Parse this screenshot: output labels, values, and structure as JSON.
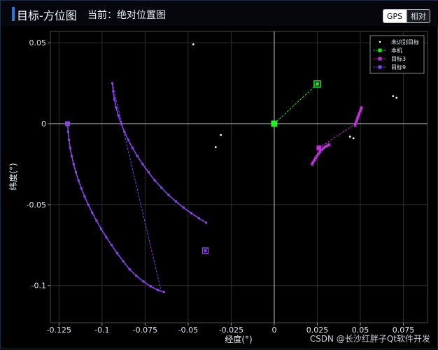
{
  "header": {
    "title": "目标-方位图",
    "subtitle": "当前：绝对位置图",
    "mode_gps": "GPS",
    "mode_relative": "相对"
  },
  "watermark": "CSDN @长沙红胖子Qt软件开发",
  "colors": {
    "unknown": "#ffffff",
    "self": "#22ee22",
    "target3": "#c030d8",
    "target9": "#8a44ee",
    "grid": "#2e2e2e",
    "axis": "#c8c8c8"
  },
  "chart_data": {
    "type": "scatter",
    "xlabel": "经度(°)",
    "ylabel": "纬度(°)",
    "xlim": [
      -0.13,
      0.089
    ],
    "ylim": [
      -0.123,
      0.057
    ],
    "xticks": [
      {
        "v": -0.125,
        "label": "-0.125"
      },
      {
        "v": -0.1,
        "label": "-0.1"
      },
      {
        "v": -0.075,
        "label": "-0.075"
      },
      {
        "v": -0.05,
        "label": "-0.05"
      },
      {
        "v": -0.025,
        "label": "-0.025"
      },
      {
        "v": 0,
        "label": "0"
      },
      {
        "v": 0.025,
        "label": "0.025"
      },
      {
        "v": 0.05,
        "label": "0.05"
      },
      {
        "v": 0.075,
        "label": "0.075"
      }
    ],
    "yticks": [
      {
        "v": 0.05,
        "label": "0.05"
      },
      {
        "v": 0,
        "label": "0"
      },
      {
        "v": -0.05,
        "label": "-0.05"
      },
      {
        "v": -0.1,
        "label": "-0.1"
      }
    ],
    "grid": true,
    "legend_position": "top-right",
    "legend": [
      {
        "name": "未识别目标",
        "color": "#ffffff",
        "marker": "dot"
      },
      {
        "name": "本机",
        "color": "#22ee22",
        "marker": "square"
      },
      {
        "name": "目标3",
        "color": "#c030d8",
        "marker": "square"
      },
      {
        "name": "目标9",
        "color": "#8a44ee",
        "marker": "square"
      }
    ],
    "unknown_points": [
      [
        -0.047,
        0.049
      ],
      [
        -0.031,
        -0.007
      ],
      [
        -0.034,
        -0.0145
      ],
      [
        0.044,
        -0.008
      ],
      [
        0.046,
        -0.009
      ],
      [
        0.069,
        0.017
      ],
      [
        0.071,
        0.016
      ]
    ],
    "self": {
      "position": [
        0.0,
        0.0
      ],
      "link_to": [
        0.025,
        0.0245
      ]
    },
    "target3": {
      "track": [
        [
          0.022,
          -0.025
        ],
        [
          0.0225,
          -0.0238
        ],
        [
          0.0232,
          -0.0226
        ],
        [
          0.024,
          -0.0213
        ],
        [
          0.0248,
          -0.02
        ],
        [
          0.0256,
          -0.0187
        ],
        [
          0.0265,
          -0.0174
        ],
        [
          0.0275,
          -0.0162
        ],
        [
          0.0285,
          -0.0152
        ],
        [
          0.0296,
          -0.0143
        ],
        [
          0.0308,
          -0.0136
        ],
        [
          0.0319,
          -0.013
        ]
      ],
      "track2": [
        [
          0.047,
          -0.001
        ],
        [
          0.0474,
          0.0005
        ],
        [
          0.0479,
          0.002
        ],
        [
          0.0484,
          0.0035
        ],
        [
          0.0489,
          0.005
        ],
        [
          0.0494,
          0.0064
        ],
        [
          0.0499,
          0.0077
        ],
        [
          0.0503,
          0.0089
        ],
        [
          0.0506,
          0.0099
        ]
      ],
      "current": [
        0.026,
        -0.015
      ],
      "link_to": [
        0.046,
        -0.001
      ]
    },
    "target9": {
      "track": [
        [
          -0.12,
          0.0
        ],
        [
          -0.1197,
          -0.005
        ],
        [
          -0.1192,
          -0.01
        ],
        [
          -0.1185,
          -0.015
        ],
        [
          -0.1176,
          -0.02
        ],
        [
          -0.1165,
          -0.025
        ],
        [
          -0.1152,
          -0.03
        ],
        [
          -0.1137,
          -0.035
        ],
        [
          -0.112,
          -0.04
        ],
        [
          -0.1101,
          -0.045
        ],
        [
          -0.108,
          -0.05
        ],
        [
          -0.1057,
          -0.055
        ],
        [
          -0.1032,
          -0.06
        ],
        [
          -0.1005,
          -0.065
        ],
        [
          -0.0976,
          -0.07
        ],
        [
          -0.0945,
          -0.075
        ],
        [
          -0.0912,
          -0.08
        ],
        [
          -0.0877,
          -0.085
        ],
        [
          -0.084,
          -0.09
        ],
        [
          -0.0801,
          -0.094
        ],
        [
          -0.076,
          -0.0975
        ],
        [
          -0.0718,
          -0.1005
        ],
        [
          -0.0675,
          -0.1028
        ],
        [
          -0.064,
          -0.104
        ]
      ],
      "track2": [
        [
          -0.094,
          0.025
        ],
        [
          -0.0935,
          0.02
        ],
        [
          -0.0928,
          0.015
        ],
        [
          -0.0918,
          0.01
        ],
        [
          -0.0905,
          0.005
        ],
        [
          -0.0889,
          0.0
        ],
        [
          -0.087,
          -0.005
        ],
        [
          -0.0848,
          -0.01
        ],
        [
          -0.0823,
          -0.015
        ],
        [
          -0.0795,
          -0.02
        ],
        [
          -0.0764,
          -0.025
        ],
        [
          -0.073,
          -0.03
        ],
        [
          -0.0694,
          -0.035
        ],
        [
          -0.0655,
          -0.0395
        ],
        [
          -0.0614,
          -0.044
        ],
        [
          -0.0571,
          -0.048
        ],
        [
          -0.0527,
          -0.0518
        ],
        [
          -0.0482,
          -0.0553
        ],
        [
          -0.0437,
          -0.0585
        ],
        [
          -0.0395,
          -0.0612
        ]
      ],
      "current": [
        -0.12,
        0.0
      ],
      "end_marker": [
        -0.04,
        -0.0785
      ],
      "link_from": [
        -0.094,
        0.025
      ],
      "link_to": [
        -0.066,
        -0.102
      ]
    }
  }
}
